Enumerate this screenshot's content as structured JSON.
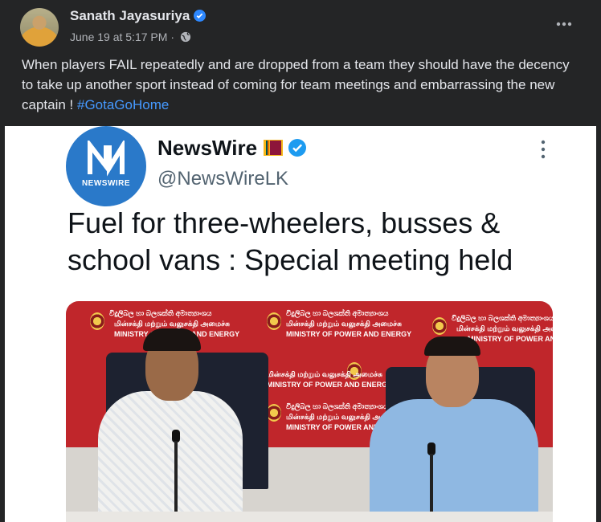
{
  "post": {
    "author": "Sanath Jayasuriya",
    "timestamp": "June 19 at 5:17 PM",
    "separator": "·",
    "audience_icon": "globe-icon",
    "more_icon": "more-horizontal-icon",
    "text": "When players FAIL repeatedly and are dropped from a team they should have the decency to take up another sport instead of coming for team meetings and embarrassing the new captain ! ",
    "hashtag": "#GotaGoHome"
  },
  "embedded_tweet": {
    "logo_word": "NEWSWIRE",
    "name": "NewsWire",
    "handle": "@NewsWireLK",
    "headline": "Fuel for three-wheelers, busses & school vans : Special meeting held",
    "more_icon": "more-vertical-icon",
    "photo_banner_lines": [
      "විදුලිබල හා බලශක්ති අමාත්‍යාංශය",
      "மின்சக்தி மற்றும் வலுசக்தி அமைச்சு",
      "MINISTRY OF POWER AND ENERGY"
    ]
  },
  "colors": {
    "background": "#242526",
    "text_primary": "#e4e6eb",
    "text_secondary": "#b0b3b8",
    "hashtag": "#4599ff",
    "verified_blue": "#1d9bf0",
    "newswire_blue": "#2a79c9"
  }
}
